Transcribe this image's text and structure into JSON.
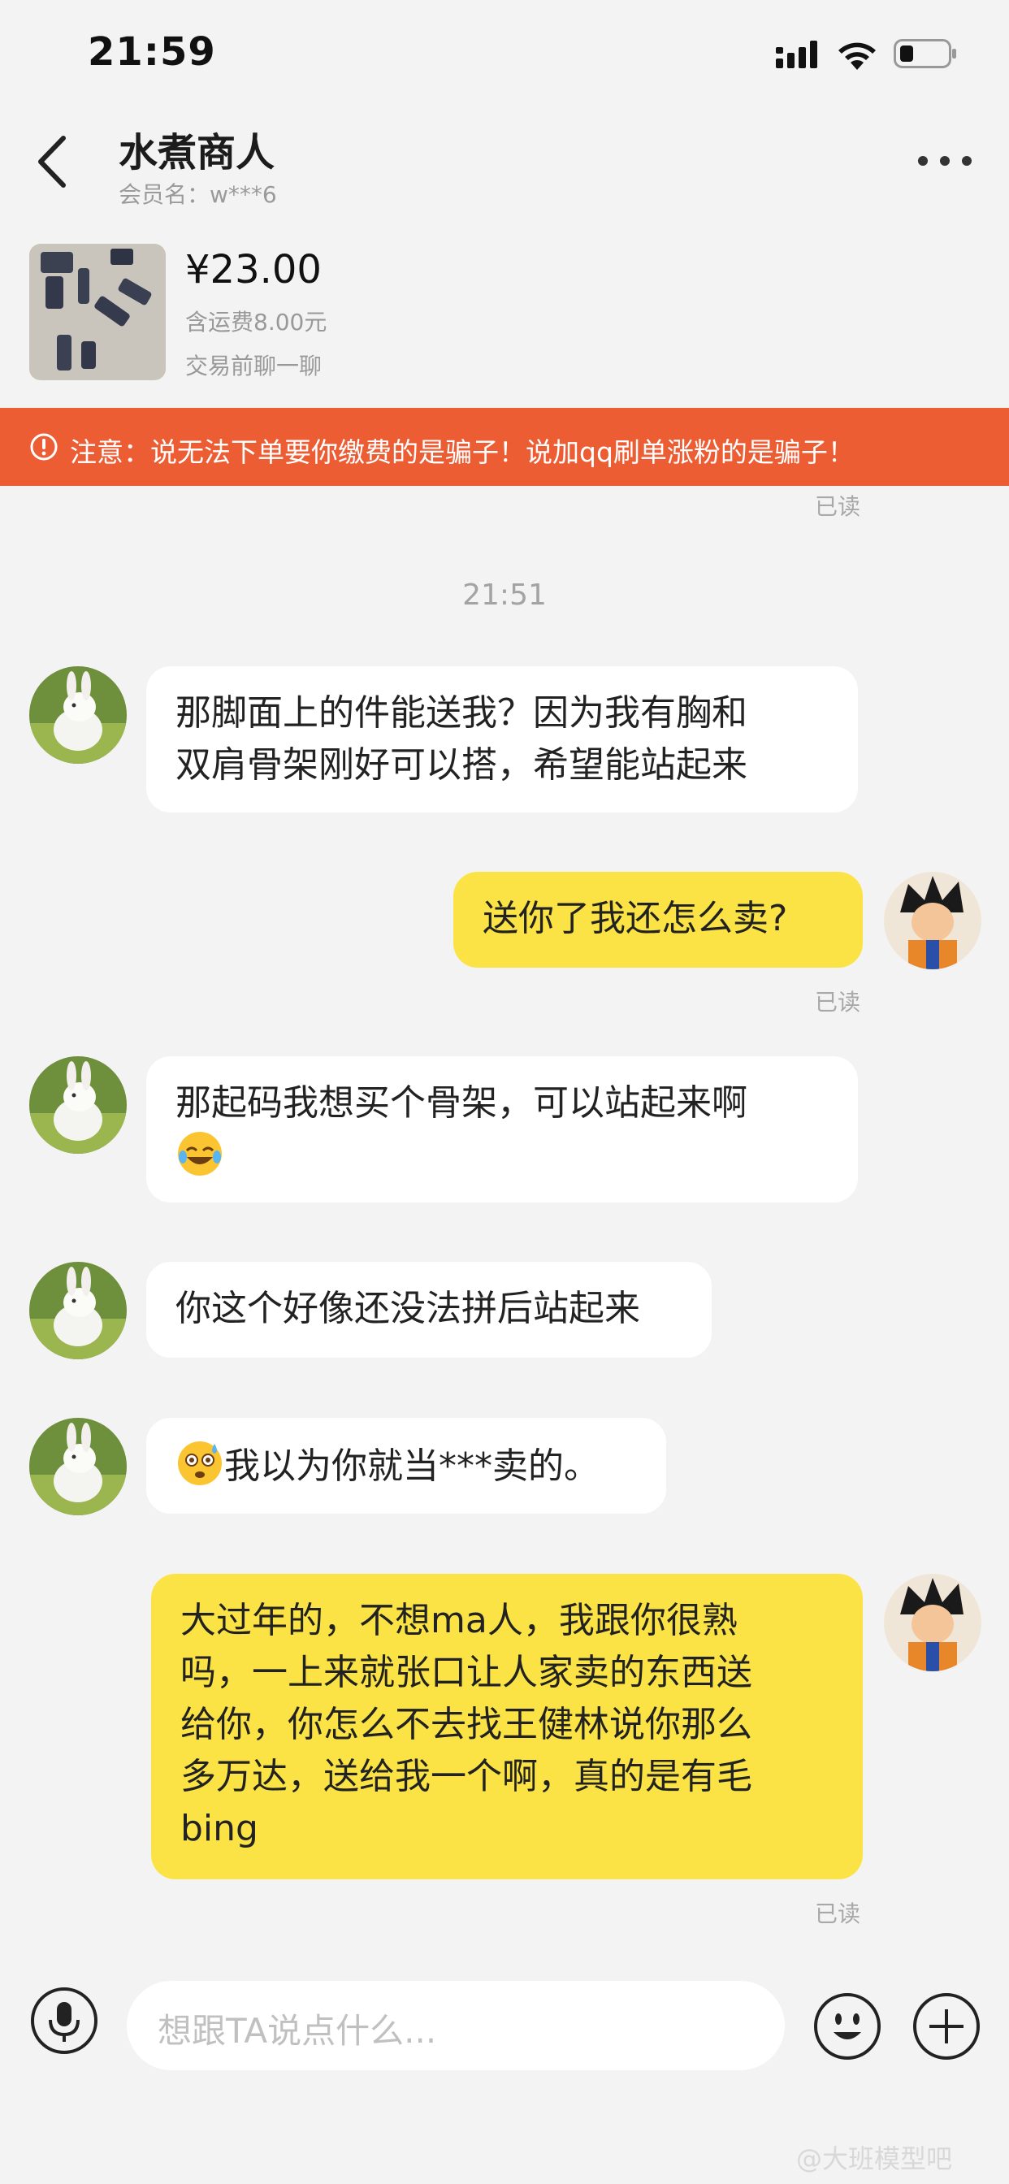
{
  "status_bar": {
    "time": "21:59"
  },
  "header": {
    "title": "水煮商人",
    "member": "会员名：w***6"
  },
  "product": {
    "price": "¥23.00",
    "shipping": "含运费8.00元",
    "note": "交易前聊一聊"
  },
  "banner": {
    "text": "注意：说无法下单要你缴费的是骗子！说加qq刷单涨粉的是骗子！"
  },
  "read_label": "已读",
  "time_divider": "21:51",
  "messages": [
    {
      "side": "in",
      "lines": [
        "那脚面上的件能送我？因为我有胸和",
        "双肩骨架刚好可以搭，希望能站起来"
      ]
    },
    {
      "side": "out",
      "lines": [
        "送你了我还怎么卖?"
      ]
    },
    {
      "side": "in",
      "lines": [
        "那起码我想买个骨架，可以站起来啊"
      ],
      "emoji": "tears-of-joy-emoji"
    },
    {
      "side": "in",
      "lines": [
        "你这个好像还没法拼后站起来"
      ]
    },
    {
      "side": "in",
      "text_after_emoji": "我以为你就当***卖的。",
      "emoji": "flushed-sweat-emoji"
    },
    {
      "side": "out",
      "lines": [
        "大过年的，不想ma人，我跟你很熟",
        "吗，一上来就张口让人家卖的东西送",
        "给你，你怎么不去找王健林说你那么",
        "多万达，送给我一个啊，真的是有毛",
        "bing"
      ]
    }
  ],
  "input": {
    "placeholder": "想跟TA说点什么..."
  },
  "icons": [
    "back-icon",
    "more-icon",
    "signal-icon",
    "wifi-icon",
    "battery-icon",
    "warning-icon",
    "mic-icon",
    "emoji-icon",
    "plus-icon"
  ],
  "watermark": "@大班模型吧",
  "colors": {
    "banner": "#ec5d34",
    "outgoing_bubble": "#fbe346",
    "incoming_bubble": "#ffffff",
    "background": "#f3f3f3"
  }
}
